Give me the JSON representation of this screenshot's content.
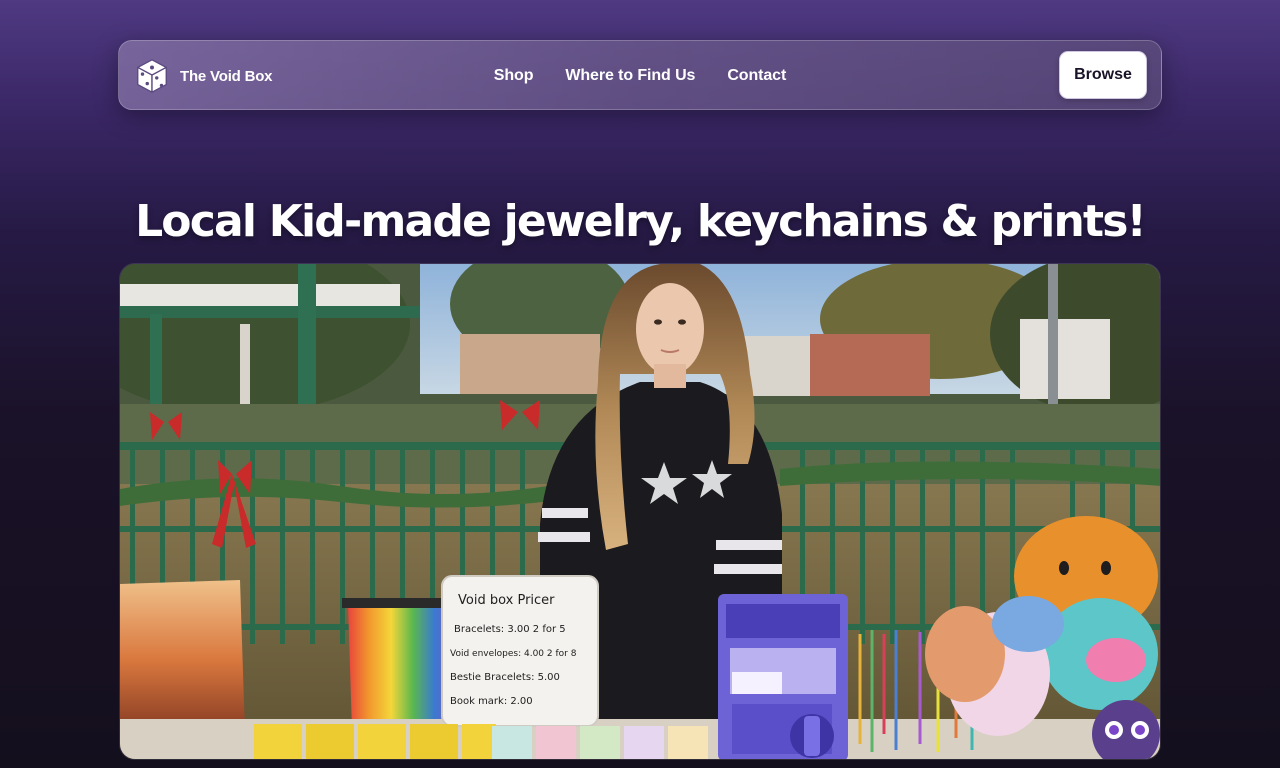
{
  "brand": {
    "name": "The Void Box",
    "logo_icon": "dice-cube-icon"
  },
  "nav": {
    "links": [
      {
        "label": "Shop"
      },
      {
        "label": "Where to Find Us"
      },
      {
        "label": "Contact"
      }
    ],
    "cta_label": "Browse"
  },
  "hero": {
    "title": "Local Kid-made jewelry, keychains & prints!",
    "sign": {
      "line1": "Void box Pricer",
      "line2": "Bracelets: 3.00 2 for 5",
      "line3": "Void envelopes: 4.00 2 for 8",
      "line4": "Bestie Bracelets: 5.00",
      "line5": "Book mark: 2.00"
    }
  },
  "colors": {
    "bg_top": "#4f3a82",
    "bg_bottom": "#140f1d",
    "nav_glass": "#8a78aa",
    "cta_bg": "#ffffff",
    "cta_text": "#1a1226"
  }
}
